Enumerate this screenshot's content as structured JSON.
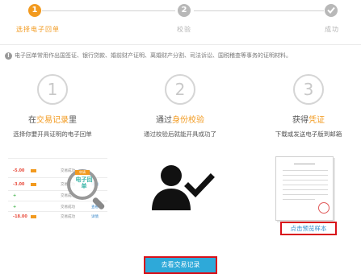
{
  "stepper": {
    "steps": [
      {
        "number": "1",
        "label": "选择电子回单",
        "state": "active"
      },
      {
        "number": "2",
        "label": "校验",
        "state": "pending"
      },
      {
        "number": "",
        "label": "成功",
        "state": "pending",
        "icon": "check-icon"
      }
    ],
    "active_color": "#f29a1f",
    "inactive_color": "#b8b8b8"
  },
  "info": {
    "icon": "info-icon",
    "text": "电子回单常用作出国签证、银行贷款、婚前财产证明、离婚财产分割、司法诉讼、国税稽查等事务的证明材料。"
  },
  "columns": [
    {
      "number": "1",
      "title_prefix": "在",
      "title_highlight": "交易记录",
      "title_suffix": "里",
      "desc": "选择你要开具证明的电子回单"
    },
    {
      "number": "2",
      "title_prefix": "通过",
      "title_highlight": "身份校验",
      "title_suffix": "",
      "desc": "通过校验后就能开具成功了"
    },
    {
      "number": "3",
      "title_prefix": "获得",
      "title_highlight": "凭证",
      "title_suffix": "",
      "desc": "下载或发送电子版到邮箱"
    }
  ],
  "illustration1": {
    "rows": [
      {
        "amount": "-5.00",
        "color": "red",
        "status": "交易成功",
        "link": ""
      },
      {
        "amount": "-3.00",
        "color": "red",
        "status": "交易成功",
        "link": "详情"
      },
      {
        "amount": "+",
        "color": "green",
        "status": "交易成功",
        "link": ""
      },
      {
        "amount": "+",
        "color": "green",
        "status": "交易成功",
        "link": "查看"
      },
      {
        "amount": "-18.00",
        "color": "red",
        "status": "交易成功",
        "link": "详情"
      }
    ],
    "magnifier_text": "电子回单",
    "magnifier_badge": "申请"
  },
  "illustration2": {
    "icon": "user-verified-icon"
  },
  "illustration3": {
    "icon": "document-sample-icon",
    "sample_link": "点击预览样本"
  },
  "primary_action": {
    "label": "去看交易记录",
    "color": "#2ea9d9"
  }
}
